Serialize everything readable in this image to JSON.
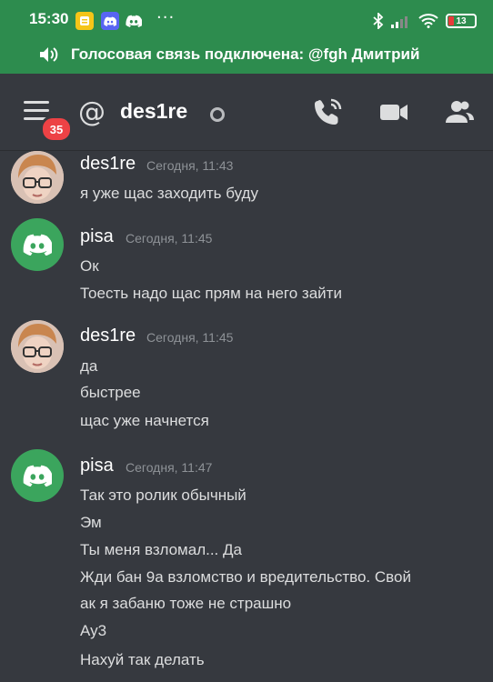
{
  "status_bar": {
    "time": "15:30",
    "battery": "13",
    "menu_dots": "···"
  },
  "voice_banner": {
    "text": "Голосовая связь подключена: @fgh Дмитрий"
  },
  "header": {
    "at_symbol": "@",
    "channel_name": "des1re",
    "unread_badge": "35"
  },
  "messages": [
    {
      "author": "des1re",
      "timestamp": "Сегодня, 11:43",
      "avatar": "face",
      "lines": [
        "я уже щас заходить буду"
      ]
    },
    {
      "author": "pisa",
      "timestamp": "Сегодня, 11:45",
      "avatar": "discord",
      "lines": [
        "Ок",
        "Тоесть надо щас прям на него зайти"
      ]
    },
    {
      "author": "des1re",
      "timestamp": "Сегодня, 11:45",
      "avatar": "face",
      "lines": [
        "да",
        "быстрее",
        "щас уже начнется"
      ]
    },
    {
      "author": "pisa",
      "timestamp": "Сегодня, 11:47",
      "avatar": "discord",
      "lines": [
        "Так это ролик обычный",
        "Эм",
        "Ты меня взломал... Да",
        "Жди бан 9а взломство и вредительство. Свой",
        "ак я забаню тоже не страшно",
        "Ау3",
        "Нахуй так делать"
      ]
    }
  ],
  "colors": {
    "voice_green": "#2d8c4e",
    "background": "#36393f",
    "discord_avatar_green": "#3ba55d",
    "badge_red": "#ed4245"
  },
  "icons": [
    "volume-icon",
    "hamburger-menu-icon",
    "at-icon",
    "phone-call-icon",
    "video-camera-icon",
    "members-icon",
    "discord-logo-icon",
    "bluetooth-icon",
    "signal-icon",
    "wifi-icon",
    "battery-icon"
  ]
}
